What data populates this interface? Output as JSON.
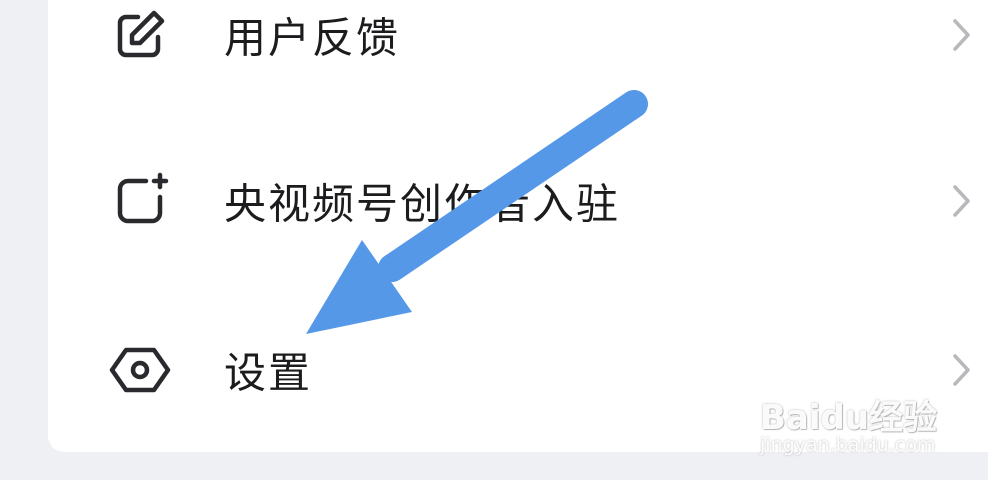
{
  "menu": {
    "items": [
      {
        "label": "用户反馈",
        "icon": "edit-icon"
      },
      {
        "label": "央视频号创作者入驻",
        "icon": "add-square-icon"
      },
      {
        "label": "设置",
        "icon": "settings-hexagon-icon"
      }
    ]
  },
  "overlay": {
    "arrow_color": "#5598e8"
  },
  "watermark": {
    "brand": "Baidu经验",
    "url": "jingyan.baidu.com"
  },
  "colors": {
    "background": "#eff0f4",
    "card": "#ffffff",
    "text": "#1c1c1e",
    "icon": "#2a2a2e",
    "chevron": "#b8b8bd"
  }
}
